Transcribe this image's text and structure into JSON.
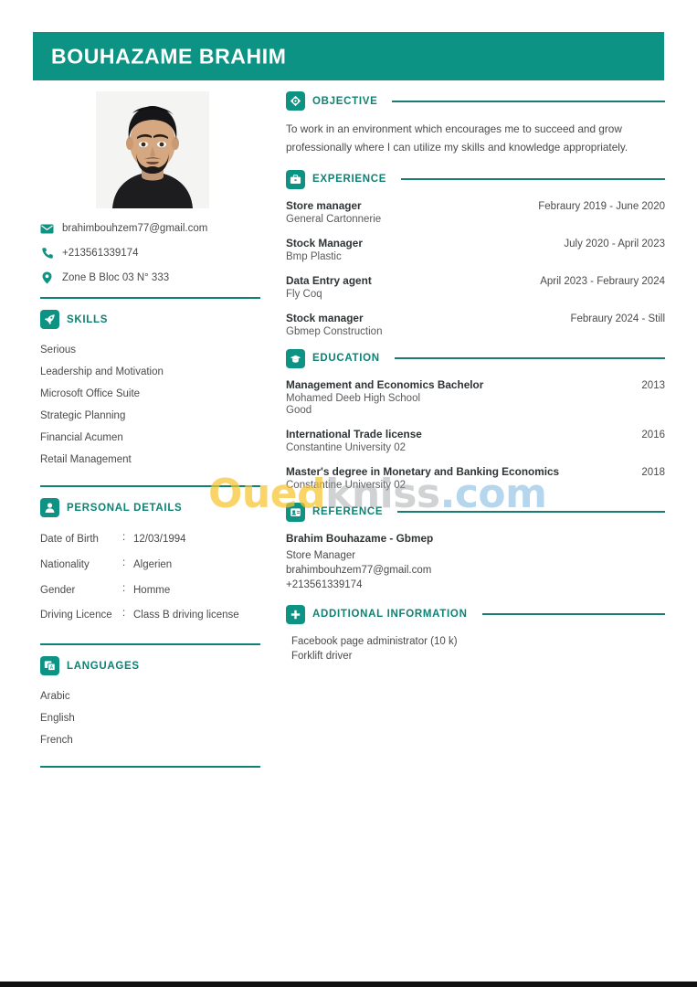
{
  "colors": {
    "accent": "#0d9384",
    "accent_dark": "#0d8275",
    "rule": "#1a7d74",
    "body_text": "#4a4a4a",
    "title_text": "#2e3436"
  },
  "header": {
    "name": "BOUHAZAME BRAHIM"
  },
  "profile_photo": {
    "alt": "portrait photo of a man with dark hair and beard wearing a black shirt"
  },
  "contact": {
    "items": [
      {
        "icon": "envelope-icon",
        "value": "brahimbouhzem77@gmail.com"
      },
      {
        "icon": "phone-icon",
        "value": "+213561339174"
      },
      {
        "icon": "location-pin-icon",
        "value": "Zone B Bloc 03 N° 333"
      }
    ]
  },
  "skills": {
    "title": "SKILLS",
    "icon": "rocket-icon",
    "items": [
      "Serious",
      "Leadership and Motivation",
      "Microsoft Office Suite",
      "Strategic Planning",
      "Financial Acumen",
      "Retail Management"
    ]
  },
  "personal_details": {
    "title": "PERSONAL DETAILS",
    "icon": "person-icon",
    "separator": ":",
    "rows": [
      {
        "label": "Date of Birth",
        "value": "12/03/1994"
      },
      {
        "label": "Nationality",
        "value": "Algerien"
      },
      {
        "label": "Gender",
        "value": "Homme"
      },
      {
        "label": "Driving Licence",
        "value": "Class B driving license"
      }
    ]
  },
  "languages": {
    "title": "LANGUAGES",
    "icon": "language-icon",
    "items": [
      "Arabic",
      "English",
      "French"
    ]
  },
  "objective": {
    "title": "OBJECTIVE",
    "icon": "target-icon",
    "text": "To work in an environment which encourages me to succeed and grow professionally where I can utilize my skills and knowledge appropriately."
  },
  "experience": {
    "title": "EXPERIENCE",
    "icon": "briefcase-icon",
    "entries": [
      {
        "role": "Store manager",
        "date": "Febraury 2019 - June 2020",
        "company": "General Cartonnerie"
      },
      {
        "role": "Stock Manager",
        "date": "July 2020 - April 2023",
        "company": "Bmp Plastic"
      },
      {
        "role": "Data Entry agent",
        "date": "April 2023 - Febraury 2024",
        "company": "Fly Coq"
      },
      {
        "role": "Stock manager",
        "date": "Febraury 2024 - Still",
        "company": "Gbmep Construction"
      }
    ]
  },
  "education": {
    "title": "EDUCATION",
    "icon": "graduation-cap-icon",
    "entries": [
      {
        "degree": "Management and Economics Bachelor",
        "year": "2013",
        "school": "Mohamed Deeb High School",
        "grade": "Good"
      },
      {
        "degree": "International Trade license",
        "year": "2016",
        "school": "Constantine University 02",
        "grade": ""
      },
      {
        "degree": "Master's degree in Monetary and Banking Economics",
        "year": "2018",
        "school": "Constantine University 02",
        "grade": ""
      }
    ]
  },
  "reference": {
    "title": "REFERENCE",
    "icon": "reference-badge-icon",
    "name": "Brahim Bouhazame - Gbmep",
    "role": "Store Manager",
    "email": "brahimbouhzem77@gmail.com",
    "phone": "+213561339174"
  },
  "additional_information": {
    "title": "ADDITIONAL INFORMATION",
    "icon": "plus-icon",
    "items": [
      "Facebook page administrator (10 k)",
      "Forklift driver"
    ]
  },
  "watermark": {
    "part1": "Oued",
    "part2": "kniss",
    "part3": ".com"
  }
}
